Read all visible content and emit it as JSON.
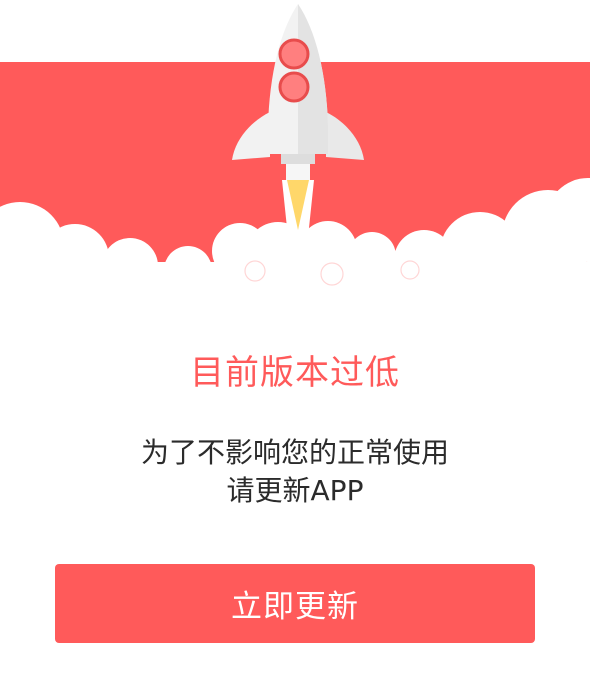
{
  "theme": {
    "accent": "#ff5a5a",
    "background": "#ffffff",
    "text": "#2b2b2b",
    "button_text": "#ffffff"
  },
  "illustration": {
    "icon": "rocket-launch-icon",
    "cloud_color": "#ffffff",
    "rocket_body_color": "#f2f2f2",
    "rocket_window_color": "#ff7f7f",
    "flame_color": "#ffd76a"
  },
  "dialog": {
    "title": "目前版本过低",
    "message_line1": "为了不影响您的正常使用",
    "message_line2": "请更新APP",
    "button_label": "立即更新"
  }
}
